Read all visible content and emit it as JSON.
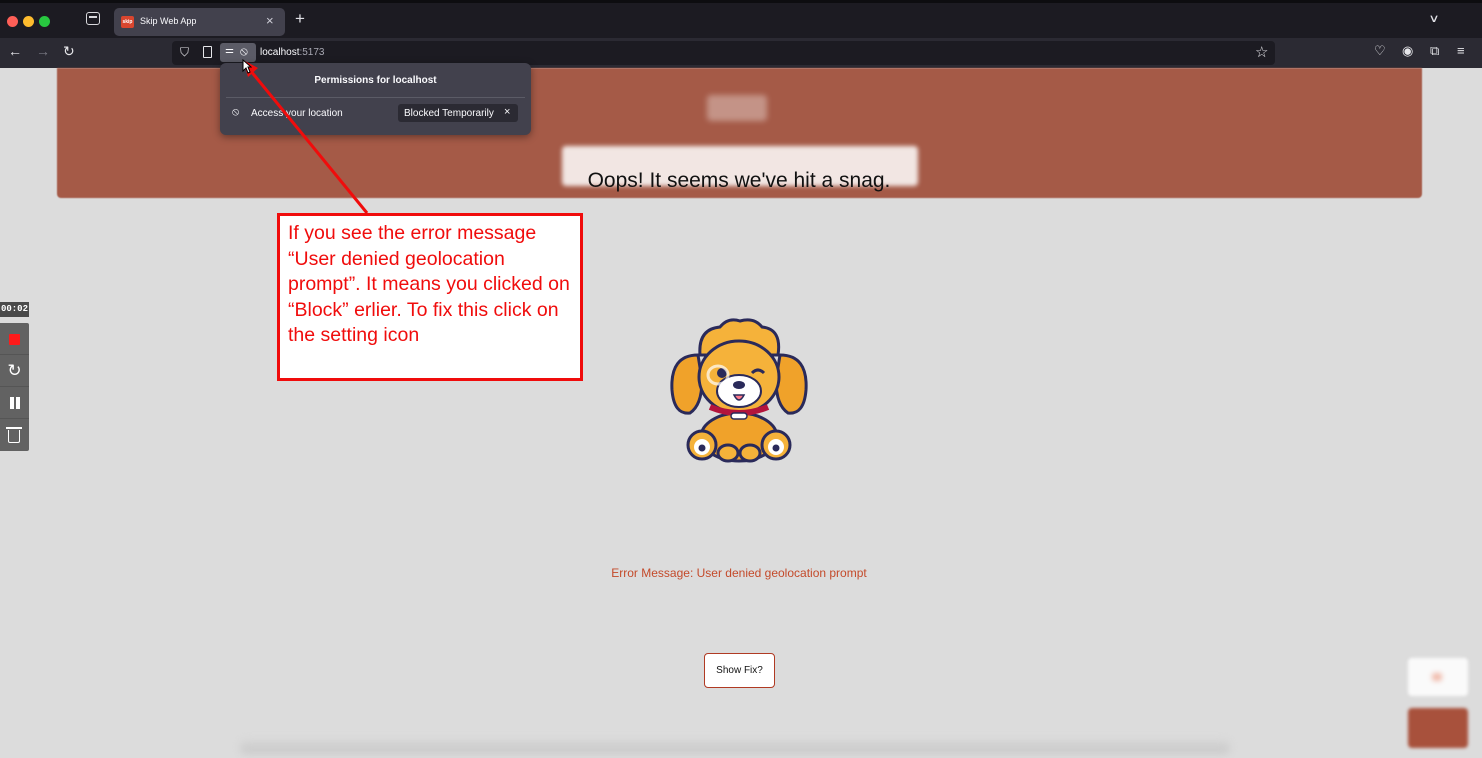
{
  "browser": {
    "tab_title": "Skip Web App",
    "tab_favicon_text": "skip",
    "url_host": "localhost",
    "url_port": ":5173",
    "icons": {
      "back": "arrow-left-icon",
      "forward": "arrow-right-icon",
      "reload": "reload-icon",
      "tracking": "shield-icon",
      "page": "page-icon",
      "permissions": "permissions-icon",
      "bookmark": "star-icon",
      "pocket": "pocket-icon",
      "account": "account-icon",
      "extensions": "puzzle-icon",
      "menu": "hamburger-menu-icon"
    }
  },
  "permissions_popup": {
    "title": "Permissions for localhost",
    "item_label": "Access your location",
    "item_status": "Blocked Temporarily"
  },
  "page": {
    "headline": "Oops! It seems we've hit a snag.",
    "error_message": "Error Message: User denied geolocation prompt",
    "fix_button": "Show Fix?",
    "accent_color": "#a55a47",
    "error_color": "#c44a2a"
  },
  "annotation": {
    "text": "If you see the error message “User denied geolocation prompt”. It means you clicked on “Block” erlier. To fix this click on the setting icon",
    "color": "#f00c0c"
  },
  "recorder": {
    "timer": "00:02"
  }
}
